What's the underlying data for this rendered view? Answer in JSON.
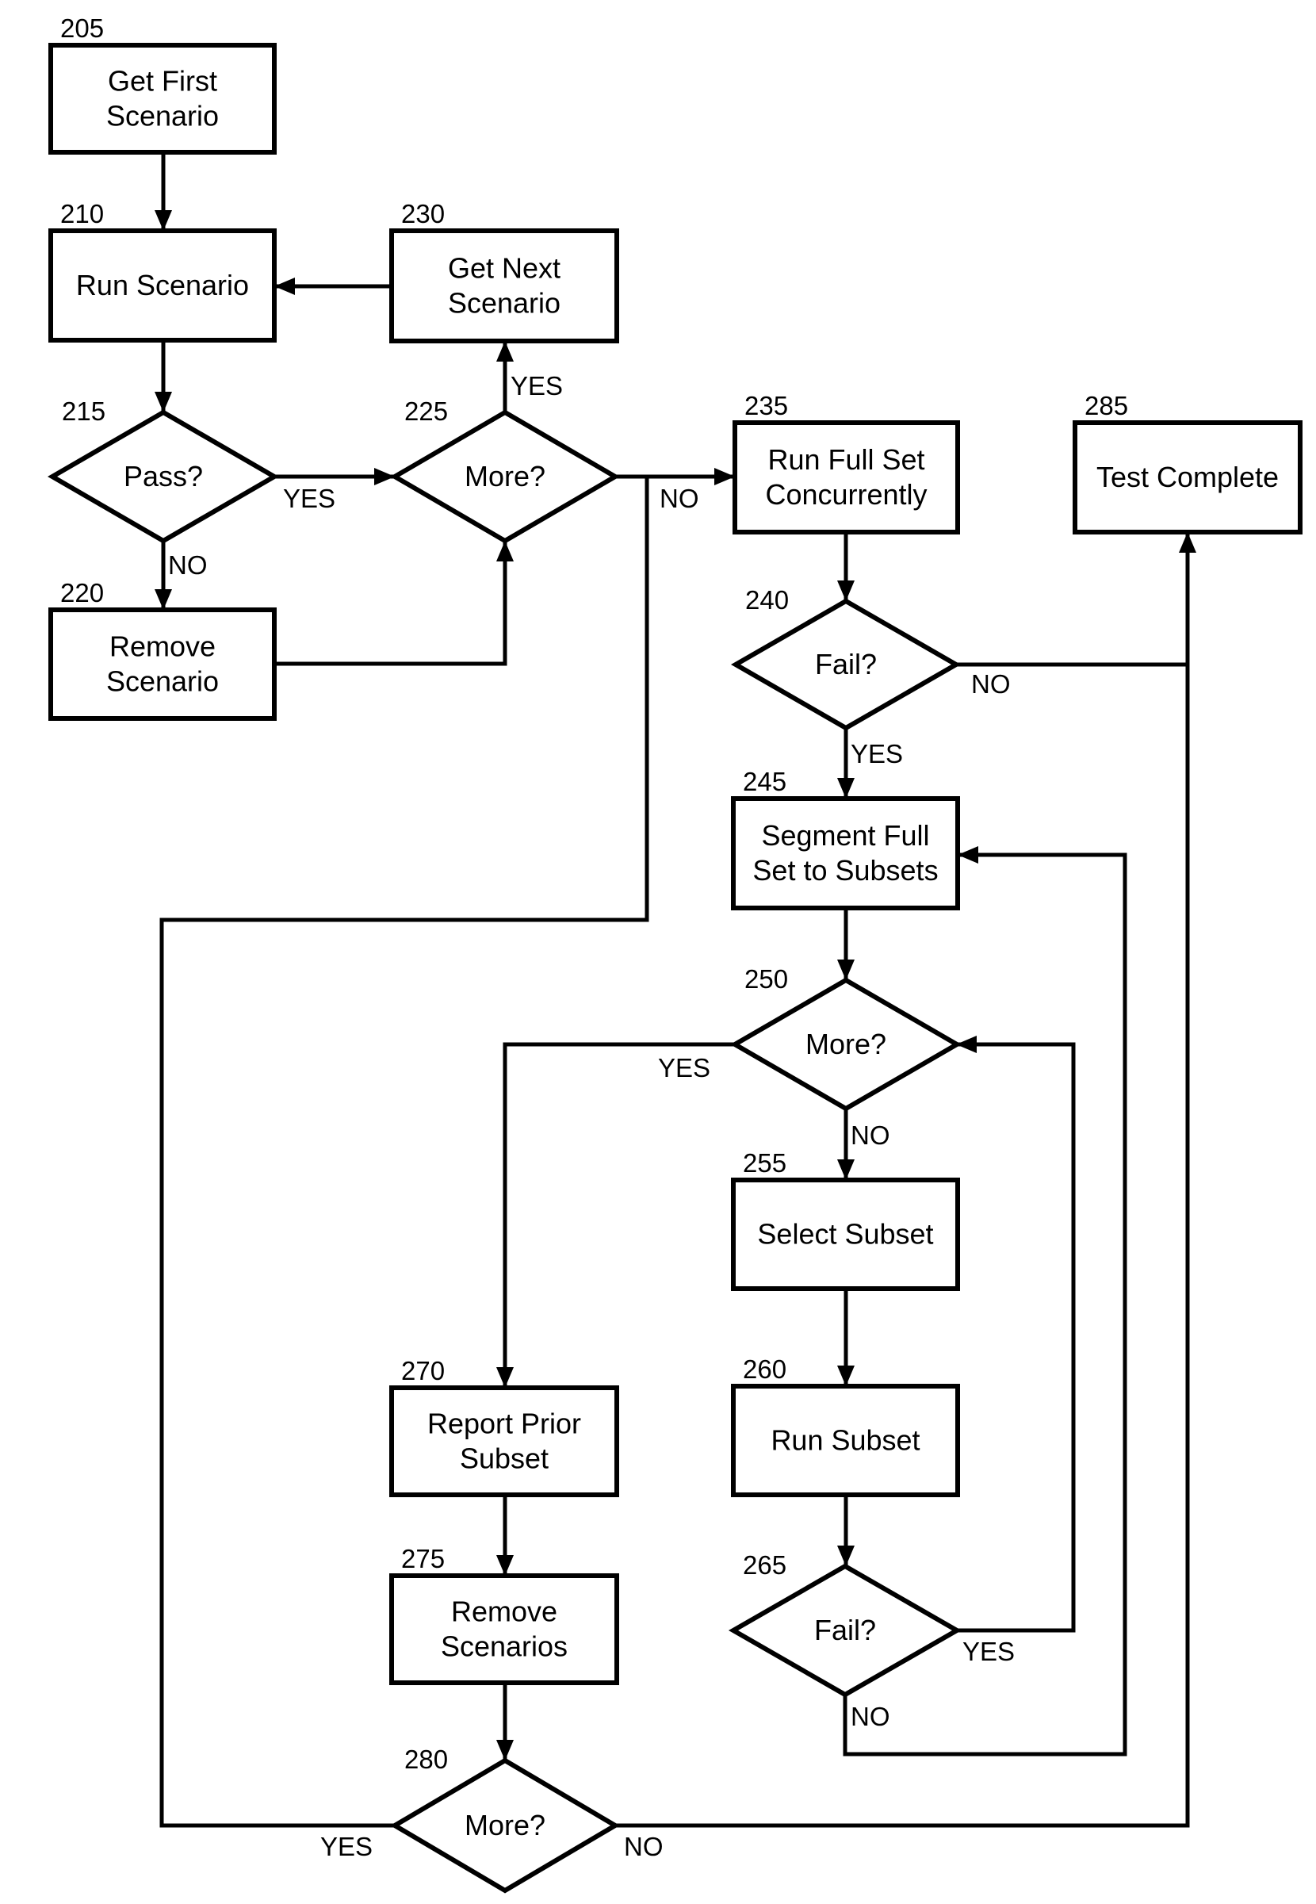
{
  "diagram": {
    "type": "flowchart",
    "nodes": [
      {
        "id": "205",
        "shape": "process",
        "lines": [
          "Get First",
          "Scenario"
        ]
      },
      {
        "id": "210",
        "shape": "process",
        "lines": [
          "Run Scenario"
        ]
      },
      {
        "id": "215",
        "shape": "decision",
        "lines": [
          "Pass?"
        ]
      },
      {
        "id": "220",
        "shape": "process",
        "lines": [
          "Remove",
          "Scenario"
        ]
      },
      {
        "id": "225",
        "shape": "decision",
        "lines": [
          "More?"
        ]
      },
      {
        "id": "230",
        "shape": "process",
        "lines": [
          "Get Next",
          "Scenario"
        ]
      },
      {
        "id": "235",
        "shape": "process",
        "lines": [
          "Run Full Set",
          "Concurrently"
        ]
      },
      {
        "id": "240",
        "shape": "decision",
        "lines": [
          "Fail?"
        ]
      },
      {
        "id": "245",
        "shape": "process",
        "lines": [
          "Segment Full",
          "Set to Subsets"
        ]
      },
      {
        "id": "250",
        "shape": "decision",
        "lines": [
          "More?"
        ]
      },
      {
        "id": "255",
        "shape": "process",
        "lines": [
          "Select Subset"
        ]
      },
      {
        "id": "260",
        "shape": "process",
        "lines": [
          "Run Subset"
        ]
      },
      {
        "id": "265",
        "shape": "decision",
        "lines": [
          "Fail?"
        ]
      },
      {
        "id": "270",
        "shape": "process",
        "lines": [
          "Report Prior",
          "Subset"
        ]
      },
      {
        "id": "275",
        "shape": "process",
        "lines": [
          "Remove",
          "Scenarios"
        ]
      },
      {
        "id": "280",
        "shape": "decision",
        "lines": [
          "More?"
        ]
      },
      {
        "id": "285",
        "shape": "process",
        "lines": [
          "Test Complete"
        ]
      }
    ],
    "edges": [
      {
        "from": "205",
        "to": "210",
        "label": ""
      },
      {
        "from": "210",
        "to": "215",
        "label": ""
      },
      {
        "from": "215",
        "to": "225",
        "label": "YES"
      },
      {
        "from": "215",
        "to": "220",
        "label": "NO"
      },
      {
        "from": "220",
        "to": "225",
        "label": ""
      },
      {
        "from": "225",
        "to": "230",
        "label": "YES"
      },
      {
        "from": "230",
        "to": "210",
        "label": ""
      },
      {
        "from": "225",
        "to": "235",
        "label": "NO"
      },
      {
        "from": "235",
        "to": "240",
        "label": ""
      },
      {
        "from": "240",
        "to": "285",
        "label": "NO"
      },
      {
        "from": "240",
        "to": "245",
        "label": "YES"
      },
      {
        "from": "245",
        "to": "250",
        "label": ""
      },
      {
        "from": "250",
        "to": "270",
        "label": "YES"
      },
      {
        "from": "250",
        "to": "255",
        "label": "NO"
      },
      {
        "from": "255",
        "to": "260",
        "label": ""
      },
      {
        "from": "260",
        "to": "265",
        "label": ""
      },
      {
        "from": "265",
        "to": "250",
        "label": "YES"
      },
      {
        "from": "265",
        "to": "245",
        "label": "NO"
      },
      {
        "from": "270",
        "to": "275",
        "label": ""
      },
      {
        "from": "275",
        "to": "280",
        "label": ""
      },
      {
        "from": "280",
        "to": "225",
        "label": "YES"
      },
      {
        "from": "280",
        "to": "285",
        "label": "NO"
      }
    ]
  }
}
